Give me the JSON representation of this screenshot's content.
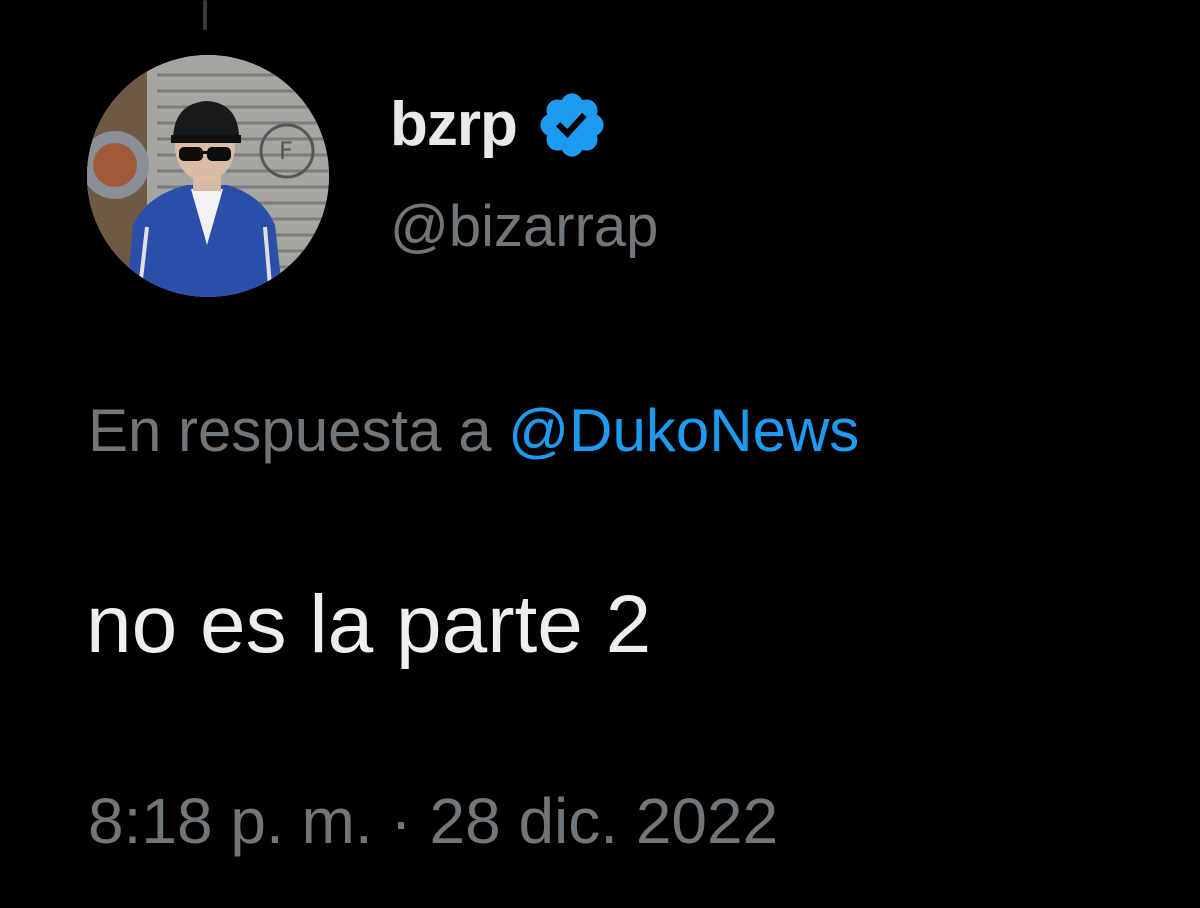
{
  "tweet": {
    "author": {
      "display_name": "bzrp",
      "handle": "@bizarrap",
      "verified": true,
      "verified_icon": "verified-badge-icon",
      "avatar_icon": "avatar-photo"
    },
    "reply_to": {
      "prefix": "En respuesta a ",
      "mention": "@DukoNews"
    },
    "text": "no es la parte 2",
    "timestamp": "8:18 p. m. · 28 dic. 2022"
  },
  "colors": {
    "background": "#000000",
    "primary_text": "#e7e9ea",
    "secondary_text": "#71767b",
    "accent": "#1d9bf0"
  }
}
